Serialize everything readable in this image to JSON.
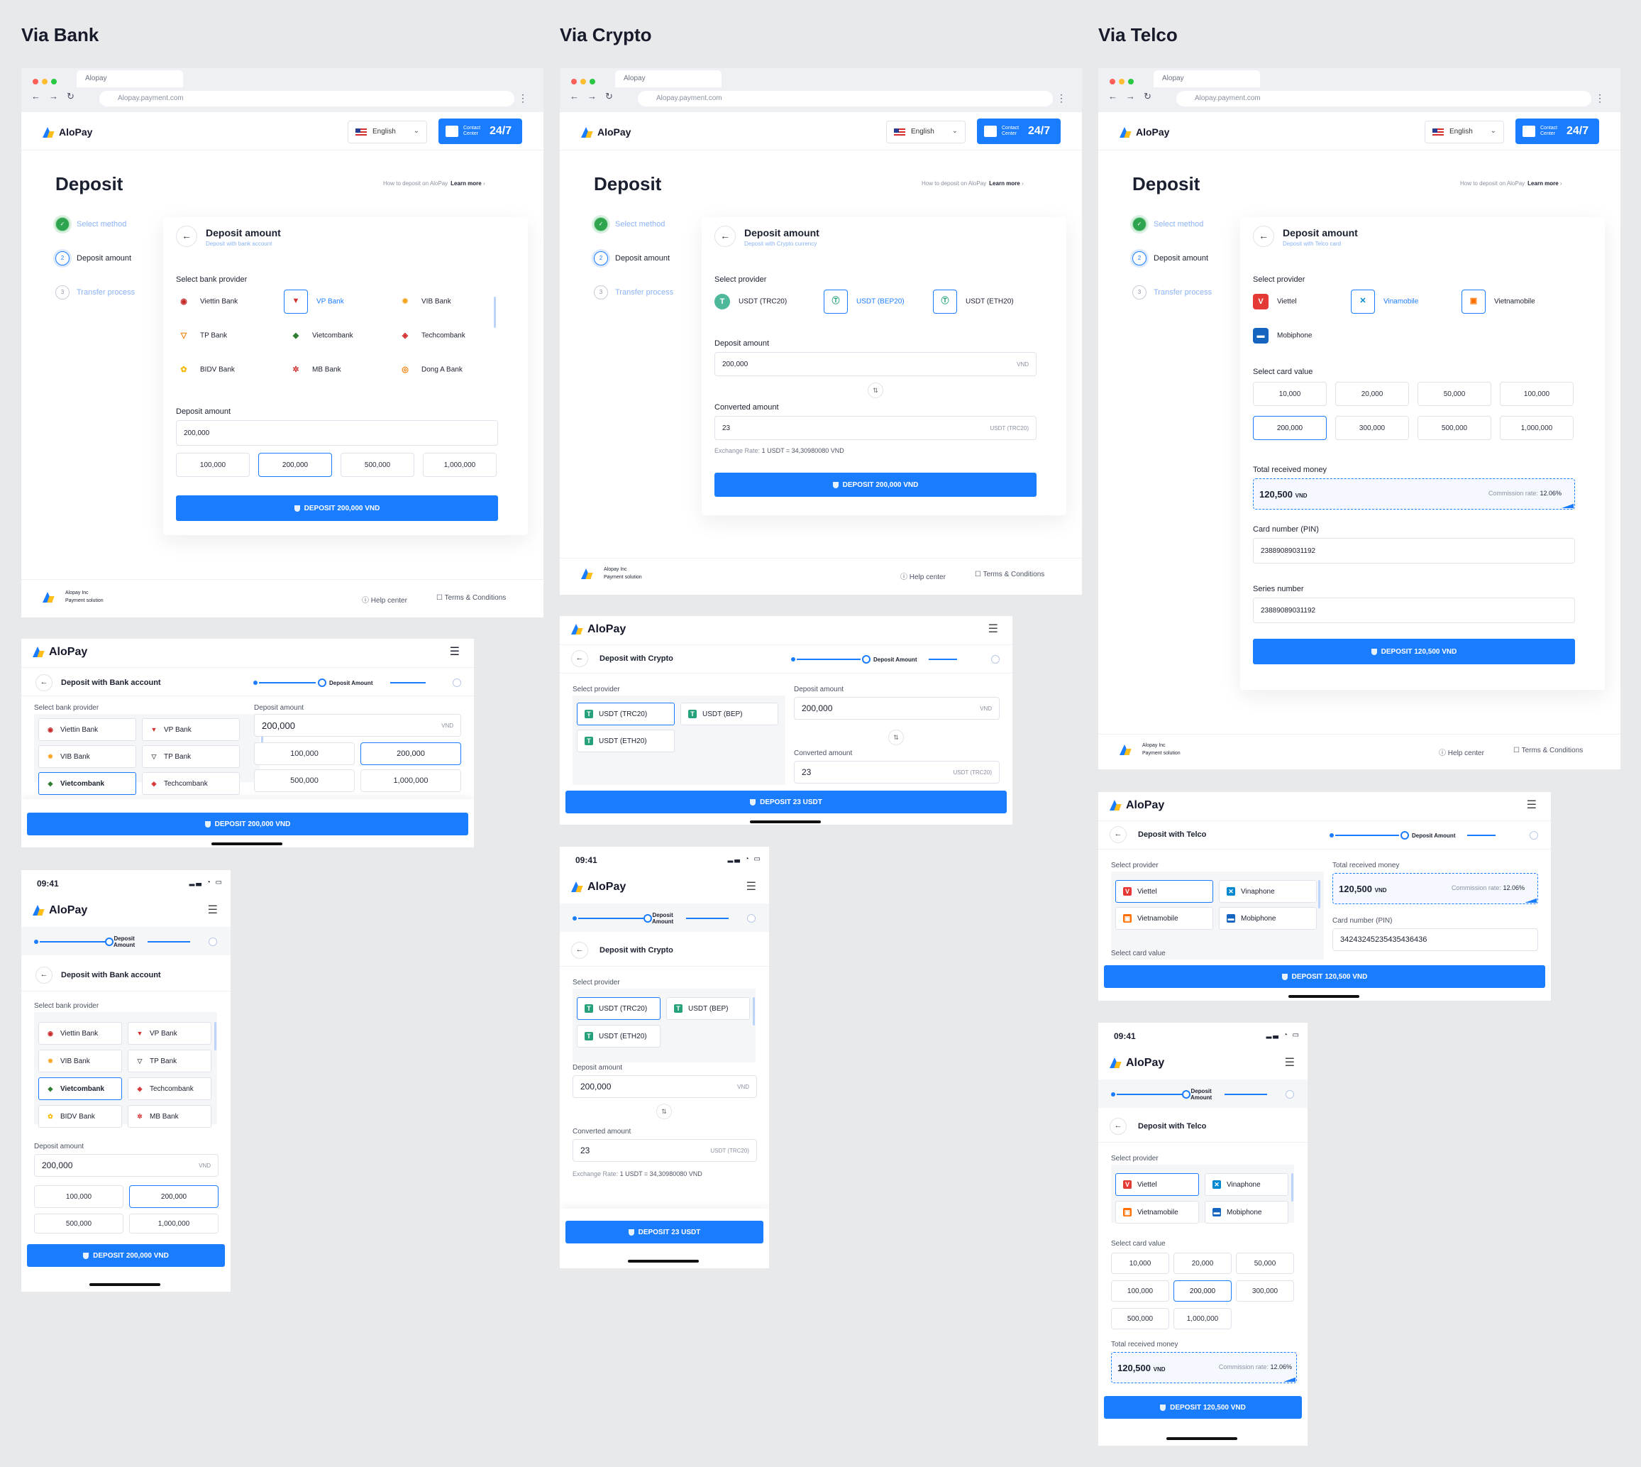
{
  "sections": {
    "bank": "Via Bank",
    "crypto": "Via Crypto",
    "telco": "Via Telco"
  },
  "browser": {
    "tab": "Alopay",
    "url": "Alopay.payment.com"
  },
  "header": {
    "brand": "AloPay",
    "language": "English",
    "contact_small": "Contact\nCenter",
    "contact_big": "24/7"
  },
  "page": {
    "title": "Deposit",
    "howto": "How to deposit on AloPay",
    "learn": "Learn more"
  },
  "steps": [
    "Select method",
    "Deposit amount",
    "Transfer process"
  ],
  "step_numbers": [
    "2",
    "3"
  ],
  "footer": {
    "company": "Alopay Inc",
    "tagline": "Payment solution",
    "help": "Help center",
    "terms": "Terms & Conditions"
  },
  "bank": {
    "form_title": "Deposit amount",
    "form_sub": "Deposit with bank account",
    "select_label": "Select bank provider",
    "providers": [
      "Viettin Bank",
      "VP Bank",
      "VIB Bank",
      "TP Bank",
      "Vietcombank",
      "Techcombank",
      "BIDV Bank",
      "MB Bank",
      "Dong A Bank"
    ],
    "amount_label": "Deposit amount",
    "amount_value": "200,000",
    "presets": [
      "100,000",
      "200,000",
      "500,000",
      "1,000,000"
    ],
    "cta": "DEPOSIT 200,000 VND",
    "m_title": "Deposit with Bank account",
    "m_progress": "Deposit Amount",
    "m_currency": "VND"
  },
  "crypto": {
    "form_title": "Deposit amount",
    "form_sub": "Deposit with Crypto currency",
    "select_label": "Select provider",
    "providers": [
      "USDT (TRC20)",
      "USDT (BEP20)",
      "USDT (ETH20)"
    ],
    "m_providers": [
      "USDT (TRC20)",
      "USDT (BEP)",
      "USDT (ETH20)"
    ],
    "amount_label": "Deposit amount",
    "amount_value": "200,000",
    "amount_unit": "VND",
    "converted_label": "Converted amount",
    "converted_value": "23",
    "converted_unit": "USDT (TRC20)",
    "rate_label": "Exchange Rate:",
    "rate_value": "1 USDT = 34,30980080 VND",
    "cta": "DEPOSIT 200,000 VND",
    "m_cta": "DEPOSIT 23 USDT",
    "m_title": "Deposit with Crypto"
  },
  "telco": {
    "form_title": "Deposit amount",
    "form_sub": "Deposit with Telco card",
    "select_label": "Select provider",
    "providers": [
      "Viettel",
      "Vinamobile",
      "Vietnamobile",
      "Mobiphone"
    ],
    "m_providers": [
      "Viettel",
      "Vinaphone",
      "Vietnamobile",
      "Mobiphone"
    ],
    "card_label": "Select card value",
    "card_values": [
      "10,000",
      "20,000",
      "50,000",
      "100,000",
      "200,000",
      "300,000",
      "500,000",
      "1,000,000"
    ],
    "total_label": "Total received money",
    "total_value": "120,500",
    "total_unit": "VND",
    "commission_label": "Commission rate:",
    "commission_value": "12.06%",
    "pin_label": "Card number (PIN)",
    "pin_value": "23889089031192",
    "m_pin_value": "34243245235435436436",
    "series_label": "Series number",
    "series_value": "23889089031192",
    "cta": "DEPOSIT 120,500 VND",
    "m_title": "Deposit with Telco"
  },
  "mobile": {
    "time": "09:41"
  },
  "colors": {
    "accent": "#1a7cff",
    "success": "#2ea44f",
    "bg": "#e8e9eb"
  }
}
